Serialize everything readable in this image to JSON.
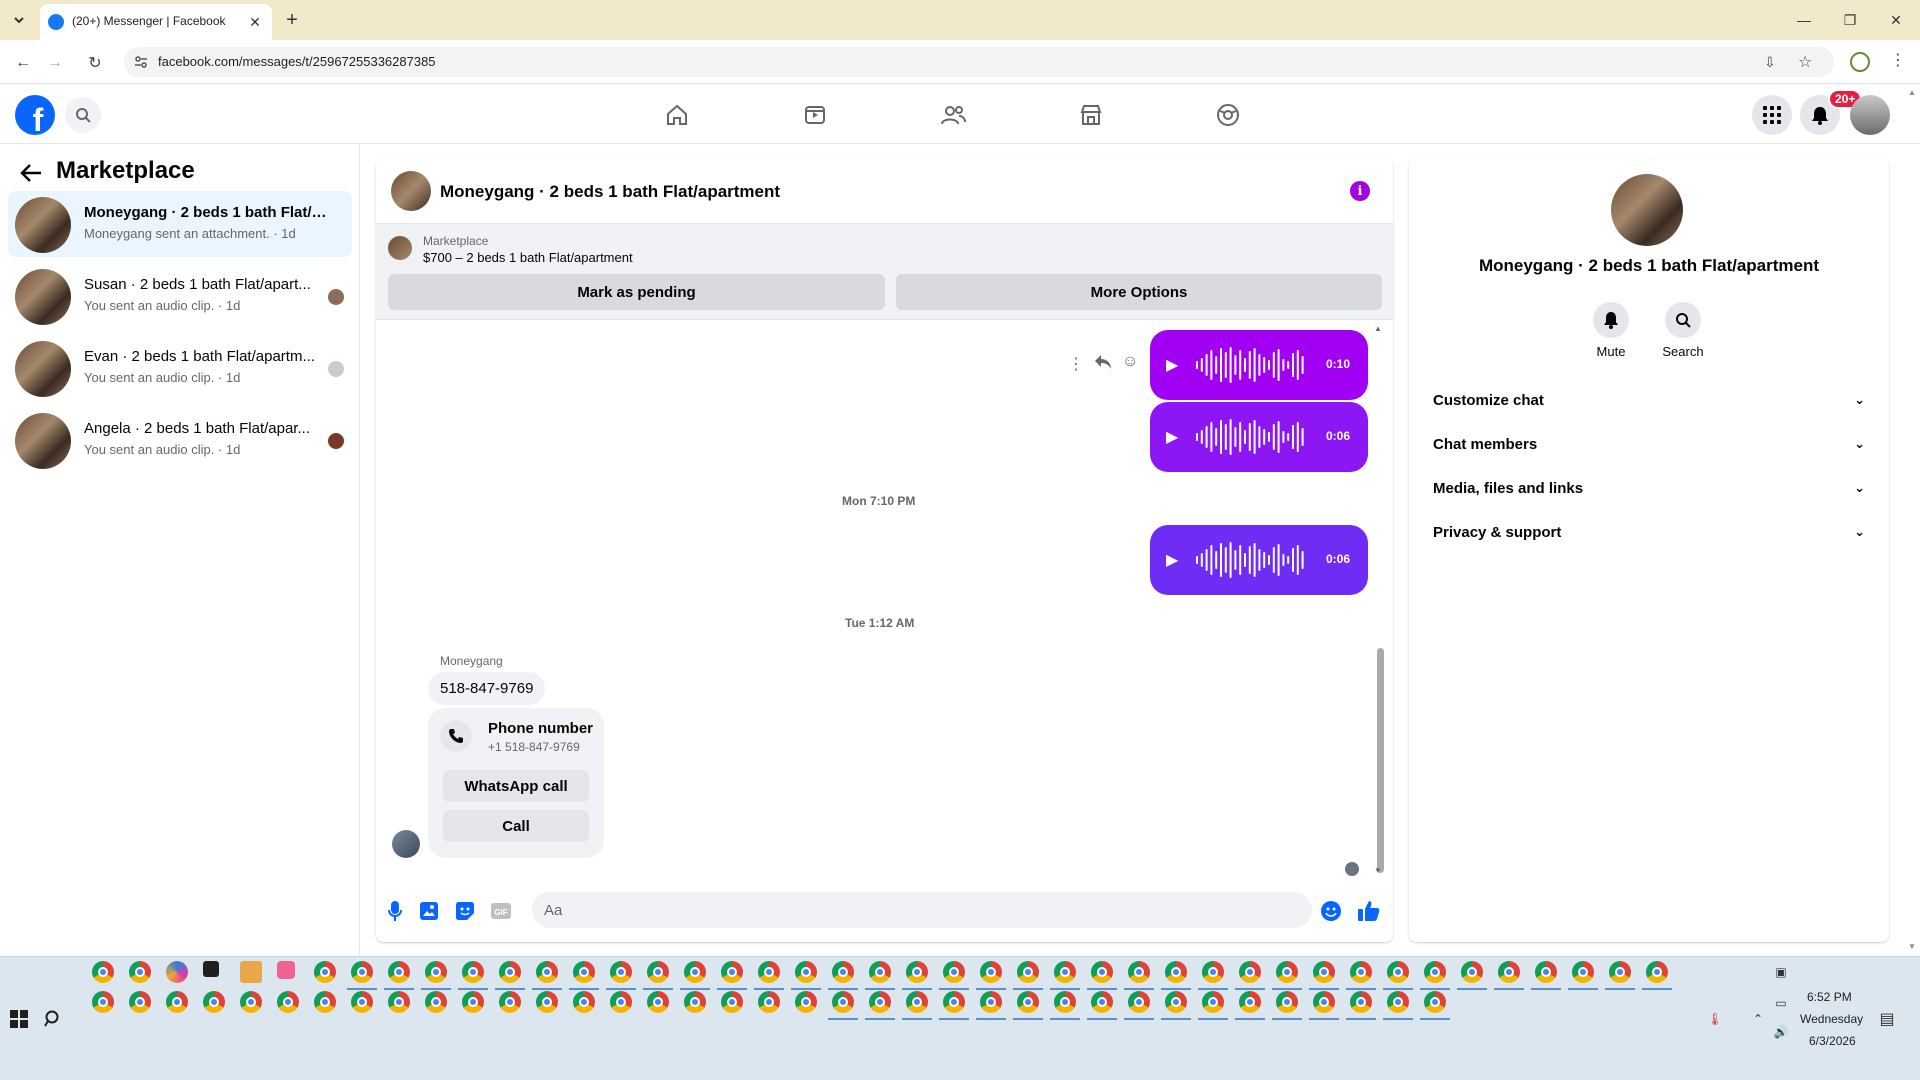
{
  "browser": {
    "tab_title": "(20+) Messenger | Facebook",
    "url": "facebook.com/messages/t/25967255336287385"
  },
  "header": {
    "notification_badge": "20+",
    "nav_icons": [
      "home-icon",
      "video-icon",
      "friends-icon",
      "marketplace-icon",
      "gaming-icon"
    ]
  },
  "sidebar": {
    "title": "Marketplace",
    "conversations": [
      {
        "name": "Moneygang · 2 beds 1 bath Flat/ap...",
        "preview": "Moneygang sent an attachment. · 1d",
        "active": true
      },
      {
        "name": "Susan · 2 beds 1 bath Flat/apart...",
        "preview": "You sent an audio clip. · 1d",
        "active": false
      },
      {
        "name": "Evan · 2 beds 1 bath Flat/apartm...",
        "preview": "You sent an audio clip. · 1d",
        "active": false
      },
      {
        "name": "Angela · 2 beds 1 bath Flat/apar...",
        "preview": "You sent an audio clip. · 1d",
        "active": false
      }
    ]
  },
  "chat": {
    "title": "Moneygang · 2 beds 1 bath Flat/apartment",
    "marketplace_label": "Marketplace",
    "listing": "$700 – 2 beds 1 bath Flat/apartment",
    "mark_pending_label": "Mark as pending",
    "more_options_label": "More Options",
    "audio_messages": [
      {
        "duration": "0:10"
      },
      {
        "duration": "0:06"
      },
      {
        "duration": "0:06"
      }
    ],
    "timestamp_1": "Mon 7:10 PM",
    "timestamp_2": "Tue 1:12 AM",
    "sender_name": "Moneygang",
    "phone_text": "518-847-9769",
    "contact_card_title": "Phone number",
    "contact_card_number": "+1 518-847-9769",
    "whatsapp_label": "WhatsApp call",
    "call_label": "Call",
    "composer_placeholder": "Aa"
  },
  "info_panel": {
    "title": "Moneygang · 2 beds 1 bath Flat/apartment",
    "mute_label": "Mute",
    "search_label": "Search",
    "sections": [
      "Customize chat",
      "Chat members",
      "Media, files and links",
      "Privacy & support"
    ]
  },
  "taskbar": {
    "time": "6:52 PM",
    "day": "Wednesday",
    "date": "6/3/2026"
  },
  "colors": {
    "audio_bubble_1": "#a100f2",
    "audio_bubble_2": "#8d16f5",
    "audio_bubble_3": "#6f2cf5",
    "fb_blue": "#0866ff",
    "active_conv": "#ebf5ff"
  }
}
